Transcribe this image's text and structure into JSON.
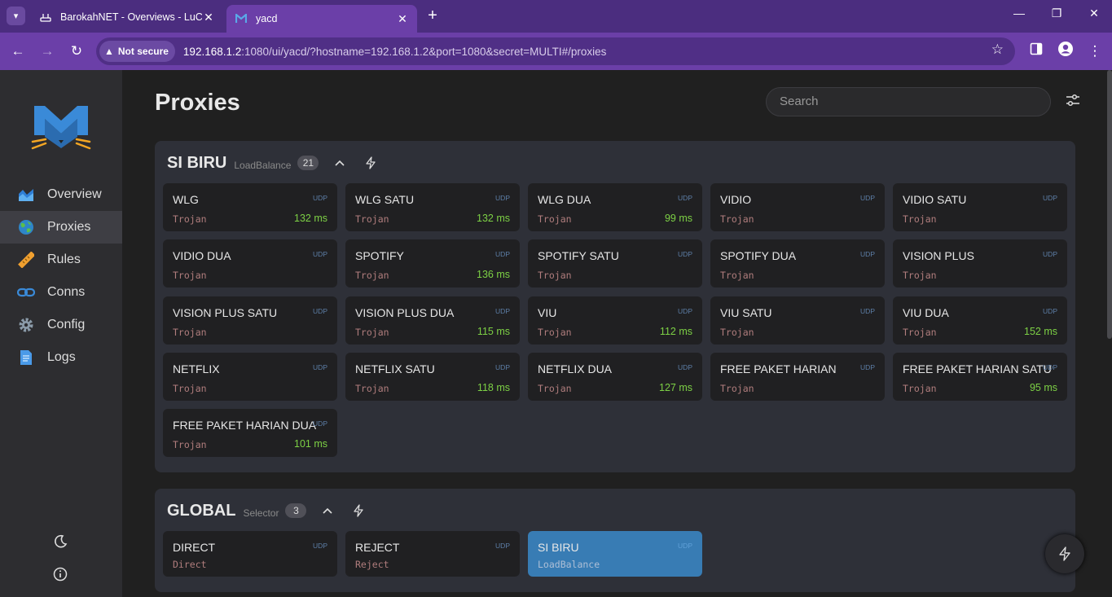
{
  "browser": {
    "tabs": [
      {
        "title": "BarokahNET - Overviews - LuCI",
        "active": false
      },
      {
        "title": "yacd",
        "active": true
      }
    ],
    "not_secure": "Not secure",
    "url_host": "192.168.1.2",
    "url_rest": ":1080/ui/yacd/?hostname=192.168.1.2&port=1080&secret=MULTI#/proxies"
  },
  "sidebar": {
    "items": [
      {
        "label": "Overview",
        "icon": "chart-icon"
      },
      {
        "label": "Proxies",
        "icon": "globe-icon"
      },
      {
        "label": "Rules",
        "icon": "ruler-icon"
      },
      {
        "label": "Conns",
        "icon": "link-icon"
      },
      {
        "label": "Config",
        "icon": "gear-icon"
      },
      {
        "label": "Logs",
        "icon": "document-icon"
      }
    ],
    "active": "Proxies"
  },
  "page": {
    "title": "Proxies",
    "search_placeholder": "Search"
  },
  "groups": [
    {
      "name": "SI BIRU",
      "type": "LoadBalance",
      "count": "21",
      "proxies": [
        {
          "name": "WLG",
          "type": "Trojan",
          "latency": "132 ms"
        },
        {
          "name": "WLG SATU",
          "type": "Trojan",
          "latency": "132 ms"
        },
        {
          "name": "WLG DUA",
          "type": "Trojan",
          "latency": "99 ms"
        },
        {
          "name": "VIDIO",
          "type": "Trojan",
          "latency": ""
        },
        {
          "name": "VIDIO SATU",
          "type": "Trojan",
          "latency": ""
        },
        {
          "name": "VIDIO DUA",
          "type": "Trojan",
          "latency": ""
        },
        {
          "name": "SPOTIFY",
          "type": "Trojan",
          "latency": "136 ms"
        },
        {
          "name": "SPOTIFY SATU",
          "type": "Trojan",
          "latency": ""
        },
        {
          "name": "SPOTIFY DUA",
          "type": "Trojan",
          "latency": ""
        },
        {
          "name": "VISION PLUS",
          "type": "Trojan",
          "latency": ""
        },
        {
          "name": "VISION PLUS SATU",
          "type": "Trojan",
          "latency": ""
        },
        {
          "name": "VISION PLUS DUA",
          "type": "Trojan",
          "latency": "115 ms"
        },
        {
          "name": "VIU",
          "type": "Trojan",
          "latency": "112 ms"
        },
        {
          "name": "VIU SATU",
          "type": "Trojan",
          "latency": ""
        },
        {
          "name": "VIU DUA",
          "type": "Trojan",
          "latency": "152 ms"
        },
        {
          "name": "NETFLIX",
          "type": "Trojan",
          "latency": ""
        },
        {
          "name": "NETFLIX SATU",
          "type": "Trojan",
          "latency": "118 ms"
        },
        {
          "name": "NETFLIX DUA",
          "type": "Trojan",
          "latency": "127 ms"
        },
        {
          "name": "FREE PAKET HARIAN",
          "type": "Trojan",
          "latency": ""
        },
        {
          "name": "FREE PAKET HARIAN SATU",
          "type": "Trojan",
          "latency": "95 ms"
        },
        {
          "name": "FREE PAKET HARIAN DUA",
          "type": "Trojan",
          "latency": "101 ms"
        }
      ]
    },
    {
      "name": "GLOBAL",
      "type": "Selector",
      "count": "3",
      "proxies": [
        {
          "name": "DIRECT",
          "type": "Direct",
          "latency": ""
        },
        {
          "name": "REJECT",
          "type": "Reject",
          "latency": ""
        },
        {
          "name": "SI BIRU",
          "type": "LoadBalance",
          "latency": "",
          "selected": true
        }
      ]
    }
  ],
  "udp_label": "UDP",
  "colors": {
    "browser_purple": "#6b3fa8",
    "latency_green": "#7dd145",
    "selected_blue": "#387cb4"
  }
}
